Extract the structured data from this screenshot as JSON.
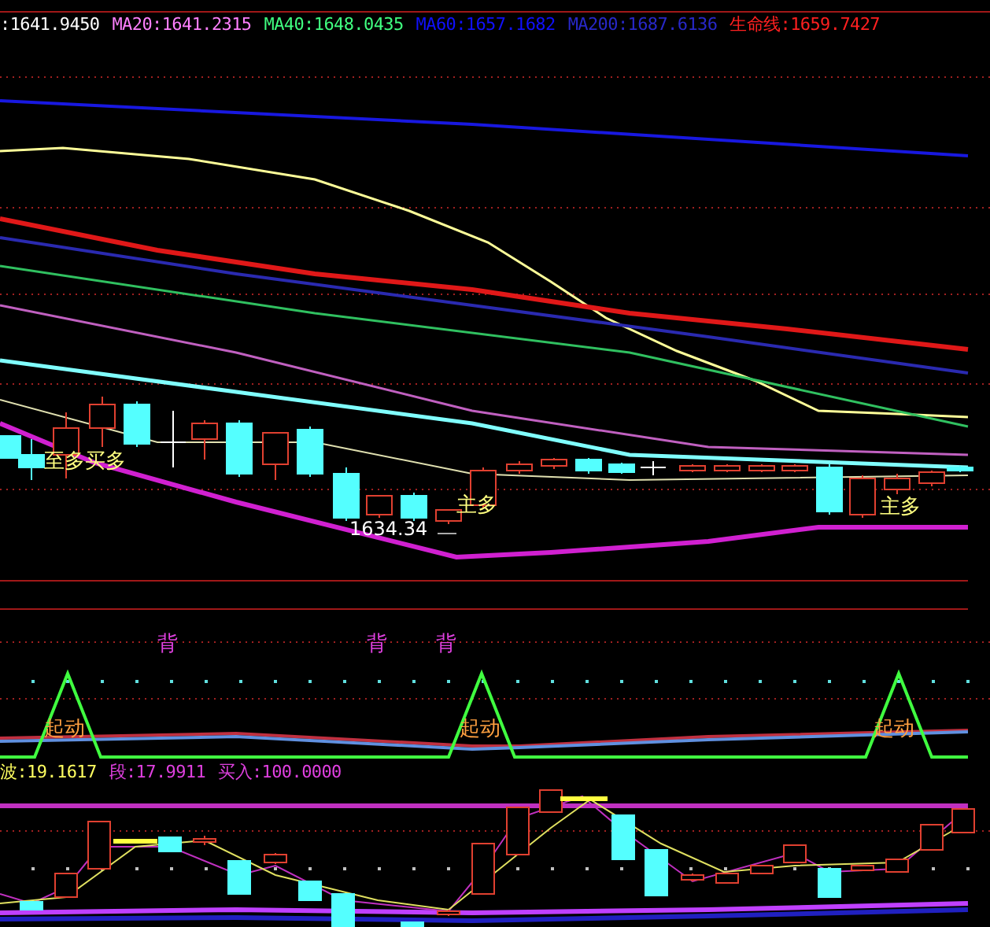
{
  "main_legend": [
    {
      "label": ":1641.9450",
      "color": "#ffffff"
    },
    {
      "label": "MA20:1641.2315",
      "color": "#ff80ff"
    },
    {
      "label": "MA40:1648.0435",
      "color": "#40ff80"
    },
    {
      "label": "MA60:1657.1682",
      "color": "#1010ff"
    },
    {
      "label": "MA200:1687.6136",
      "color": "#2828c8"
    },
    {
      "label": "生命线:1659.7427",
      "color": "#ff2020"
    }
  ],
  "price_chart": {
    "signal_texts": [
      "至多买多",
      "主多",
      "主多"
    ],
    "low_price": "1634.34"
  },
  "indicator_panel": {
    "divergence_marks": [
      "背",
      "背",
      "背"
    ],
    "start_marks": [
      "起动",
      "起动",
      "起动"
    ]
  },
  "wave_legend": [
    {
      "label": "波:19.1617",
      "color": "#ffff60"
    },
    {
      "label": "段:17.9911",
      "color": "#e040e0"
    },
    {
      "label": "买入:100.0000",
      "color": "#e040e0"
    }
  ]
}
